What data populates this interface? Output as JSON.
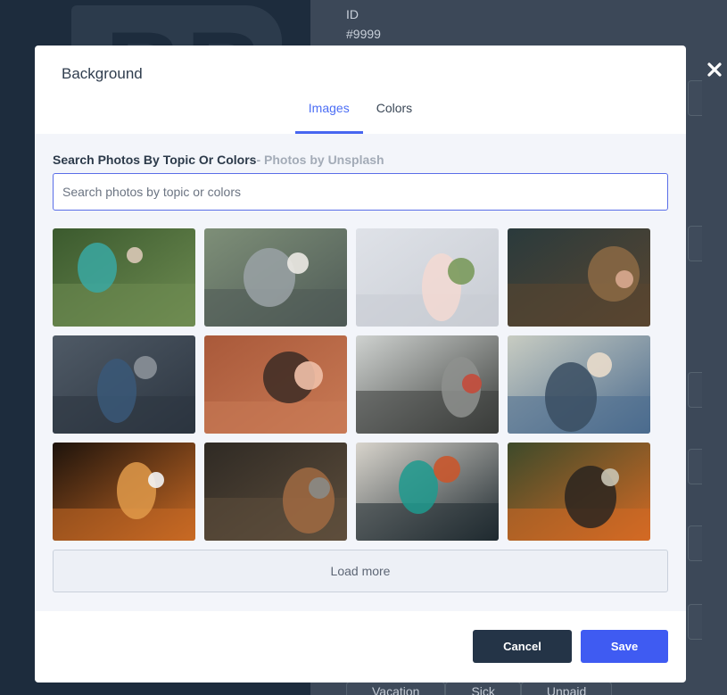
{
  "background_app": {
    "logo_letters": "BB",
    "id_label": "ID",
    "id_value": "#9999",
    "bottom_tabs": [
      "Vacation",
      "Sick",
      "Unpaid"
    ]
  },
  "modal": {
    "title": "Background",
    "tabs": [
      {
        "label": "Images",
        "active": true
      },
      {
        "label": "Colors",
        "active": false
      }
    ],
    "search": {
      "label": "Search Photos By Topic Or Colors",
      "sublabel": "- Photos by Unsplash",
      "placeholder": "Search photos by topic or colors",
      "value": ""
    },
    "photos": [
      {
        "name": "photo-woman-laptop-bench",
        "palette": [
          "#3b5a2e",
          "#6f8c52",
          "#3aa8a2",
          "#d9c8b6"
        ]
      },
      {
        "name": "photo-feet-on-dock",
        "palette": [
          "#7e8f78",
          "#4e5a56",
          "#9aa2a6",
          "#eceae4"
        ]
      },
      {
        "name": "photo-white-flowers",
        "palette": [
          "#dfe2e8",
          "#c8ccd3",
          "#f3d9d2",
          "#7a9a5c"
        ]
      },
      {
        "name": "photo-feet-in-forest",
        "palette": [
          "#2a3a3c",
          "#5a4630",
          "#8c6a44",
          "#d8a890"
        ]
      },
      {
        "name": "photo-man-sitting-city",
        "palette": [
          "#4f5a66",
          "#2c3540",
          "#3a5878",
          "#8a9098"
        ]
      },
      {
        "name": "photo-phone-archway",
        "palette": [
          "#a9593a",
          "#c97a55",
          "#3c2c25",
          "#f0c0a8"
        ]
      },
      {
        "name": "photo-motion-blur-wall",
        "palette": [
          "#cfd2d0",
          "#3a3d3a",
          "#8e918e",
          "#c44a3a"
        ]
      },
      {
        "name": "photo-man-sunglasses-denim",
        "palette": [
          "#c8ccc2",
          "#4b6b8e",
          "#3a4d62",
          "#e9dccb"
        ]
      },
      {
        "name": "photo-man-at-computer",
        "palette": [
          "#1d130c",
          "#c96a24",
          "#e09a4a",
          "#f2f3f5"
        ]
      },
      {
        "name": "photo-cases-and-rope",
        "palette": [
          "#2f2a24",
          "#5e4e3c",
          "#a06a42",
          "#8a8a86"
        ]
      },
      {
        "name": "photo-guitar-player",
        "palette": [
          "#d8d4cc",
          "#1f2a30",
          "#1f9a8e",
          "#c9562c"
        ]
      },
      {
        "name": "photo-backpack-waterfall",
        "palette": [
          "#3d4a2a",
          "#d46a24",
          "#2a2520",
          "#c9c4b4"
        ]
      }
    ],
    "load_more_label": "Load more",
    "cancel_label": "Cancel",
    "save_label": "Save"
  },
  "colors": {
    "accent": "#4c6ef5",
    "save": "#3f5bf2",
    "cancel": "#243447"
  },
  "icons": {
    "close": "close-icon"
  }
}
